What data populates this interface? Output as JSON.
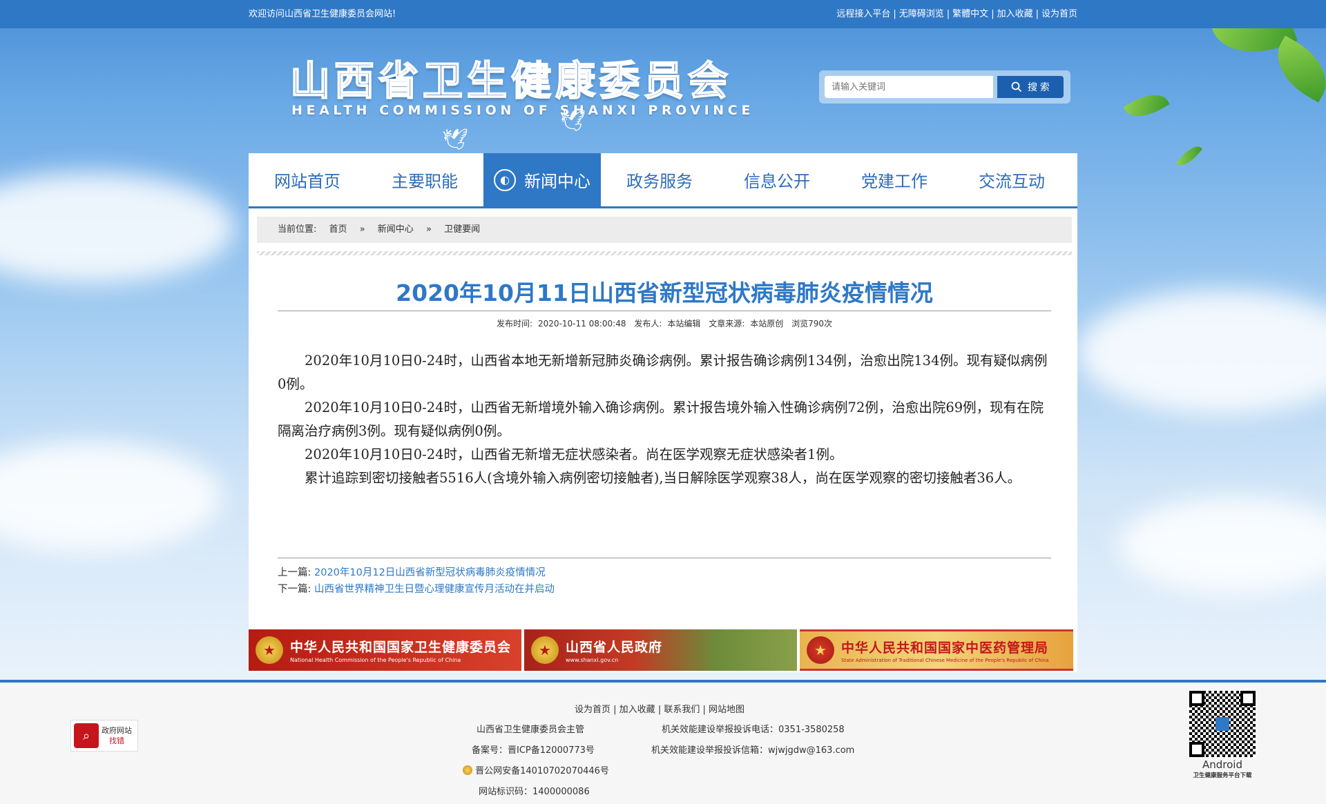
{
  "topbar": {
    "welcome": "欢迎访问山西省卫生健康委员会网站!",
    "links": [
      "远程接入平台",
      "无障碍浏览",
      "繁體中文",
      "加入收藏",
      "设为首页"
    ]
  },
  "header": {
    "logo_cn": "山西省卫生健康委员会",
    "logo_en": "HEALTH COMMISSION OF SHANXI PROVINCE",
    "search_placeholder": "请输入关键词",
    "search_button": "搜 索"
  },
  "nav": {
    "items": [
      "网站首页",
      "主要职能",
      "新闻中心",
      "政务服务",
      "信息公开",
      "党建工作",
      "交流互动"
    ],
    "active_index": 2
  },
  "breadcrumb": {
    "label": "当前位置:",
    "items": [
      "首页",
      "新闻中心",
      "卫健要闻"
    ],
    "separator": "»"
  },
  "article": {
    "title": "2020年10月11日山西省新型冠状病毒肺炎疫情情况",
    "meta": {
      "publish_time_label": "发布时间:",
      "publish_time": "2020-10-11 08:00:48",
      "publisher_label": "发布人:",
      "publisher": "本站编辑",
      "source_label": "文章来源:",
      "source": "本站原创",
      "views": "浏览790次"
    },
    "paragraphs": [
      "2020年10月10日0-24时，山西省本地无新增新冠肺炎确诊病例。累计报告确诊病例134例，治愈出院134例。现有疑似病例0例。",
      "2020年10月10日0-24时，山西省无新增境外输入确诊病例。累计报告境外输入性确诊病例72例，治愈出院69例，现有在院隔离治疗病例3例。现有疑似病例0例。",
      "2020年10月10日0-24时，山西省无新增无症状感染者。尚在医学观察无症状感染者1例。",
      "累计追踪到密切接触者5516人(含境外输入病例密切接触者),当日解除医学观察38人，尚在医学观察的密切接触者36人。"
    ],
    "prev_label": "上一篇:",
    "prev_title": "2020年10月12日山西省新型冠状病毒肺炎疫情情况",
    "next_label": "下一篇:",
    "next_title": "山西省世界精神卫生日暨心理健康宣传月活动在并启动"
  },
  "banners": [
    {
      "cn": "中华人民共和国国家卫生健康委员会",
      "en": "National Health Commission of the People's Republic of China"
    },
    {
      "cn": "山西省人民政府",
      "en": "www.shanxi.gov.cn"
    },
    {
      "cn": "中华人民共和国国家中医药管理局",
      "en": "State Administration of Traditional Chinese Medicine of the People's Republic of China"
    }
  ],
  "footer": {
    "links": [
      "设为首页",
      "加入收藏",
      "联系我们",
      "网站地图"
    ],
    "sponsor": "山西省卫生健康委员会主管",
    "icp": "备案号：晋ICP备12000773号",
    "police": "晋公网安备14010702070446号",
    "site_id": "网站标识码：1400000086",
    "complaint_phone": "机关效能建设举报投诉电话：0351-3580258",
    "complaint_email": "机关效能建设举报投诉信箱：wjwjgdw@163.com",
    "badge_top": "政府网站",
    "badge_bottom": "找错",
    "qr_label": "Android",
    "qr_sub": "卫生健康服务平台下载"
  },
  "colors": {
    "primary": "#2e78c6",
    "topbar": "#2f78c6",
    "banner_red": "#b51b12"
  }
}
